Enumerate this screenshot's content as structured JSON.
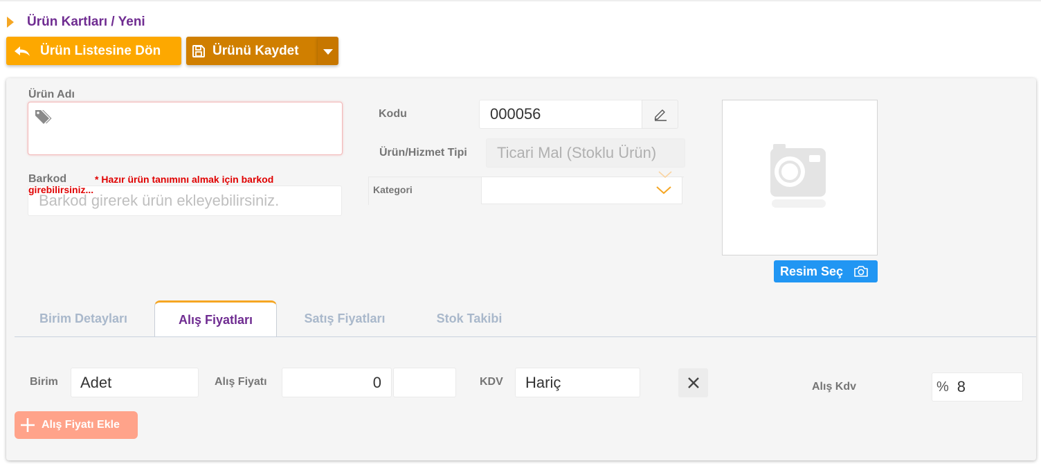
{
  "breadcrumb": "Ürün Kartları / Yeni",
  "toolbar": {
    "back_label": "Ürün Listesine Dön",
    "save_label": "Ürünü Kaydet"
  },
  "form": {
    "name_label": "Ürün Adı",
    "name_value": "",
    "barcode_label": "Barkod",
    "barcode_hint": "* Hazır ürün tanımını almak için barkod girebilirsiniz...",
    "barcode_placeholder": "Barkod girerek ürün ekleyebilirsiniz.",
    "code_label": "Kodu",
    "code_value": "000056",
    "type_label": "Ürün/Hizmet Tipi",
    "type_value": "Ticari Mal (Stoklu Ürün)",
    "category_label": "Kategori",
    "category_value": "",
    "image_button": "Resim Seç"
  },
  "tabs": [
    {
      "label": "Birim Detayları",
      "active": false
    },
    {
      "label": "Alış Fiyatları",
      "active": true
    },
    {
      "label": "Satış Fiyatları",
      "active": false
    },
    {
      "label": "Stok Takibi",
      "active": false
    }
  ],
  "purchase": {
    "unit_label": "Birim",
    "unit_value": "Adet",
    "price_label": "Alış Fiyatı",
    "price_value": "0",
    "price_extra": "",
    "vat_label": "KDV",
    "vat_value": "Hariç",
    "vat_rate_label": "Alış Kdv",
    "vat_rate_prefix": "%",
    "vat_rate_value": "8",
    "add_label": "Alış Fiyatı Ekle"
  },
  "colors": {
    "accent_orange": "#fda800",
    "save_orange": "#d07f00",
    "brand_purple": "#6f2c91",
    "image_button_blue": "#2196f3",
    "add_button_salmon": "#ffa38a",
    "warning_red": "#e00000"
  },
  "icons": [
    "undo-icon",
    "floppy-disk-icon",
    "caret-down-icon",
    "tag-icon",
    "pencil-icon",
    "chevron-down-icon",
    "camera-placeholder-icon",
    "camera-icon",
    "close-icon",
    "plus-icon"
  ]
}
